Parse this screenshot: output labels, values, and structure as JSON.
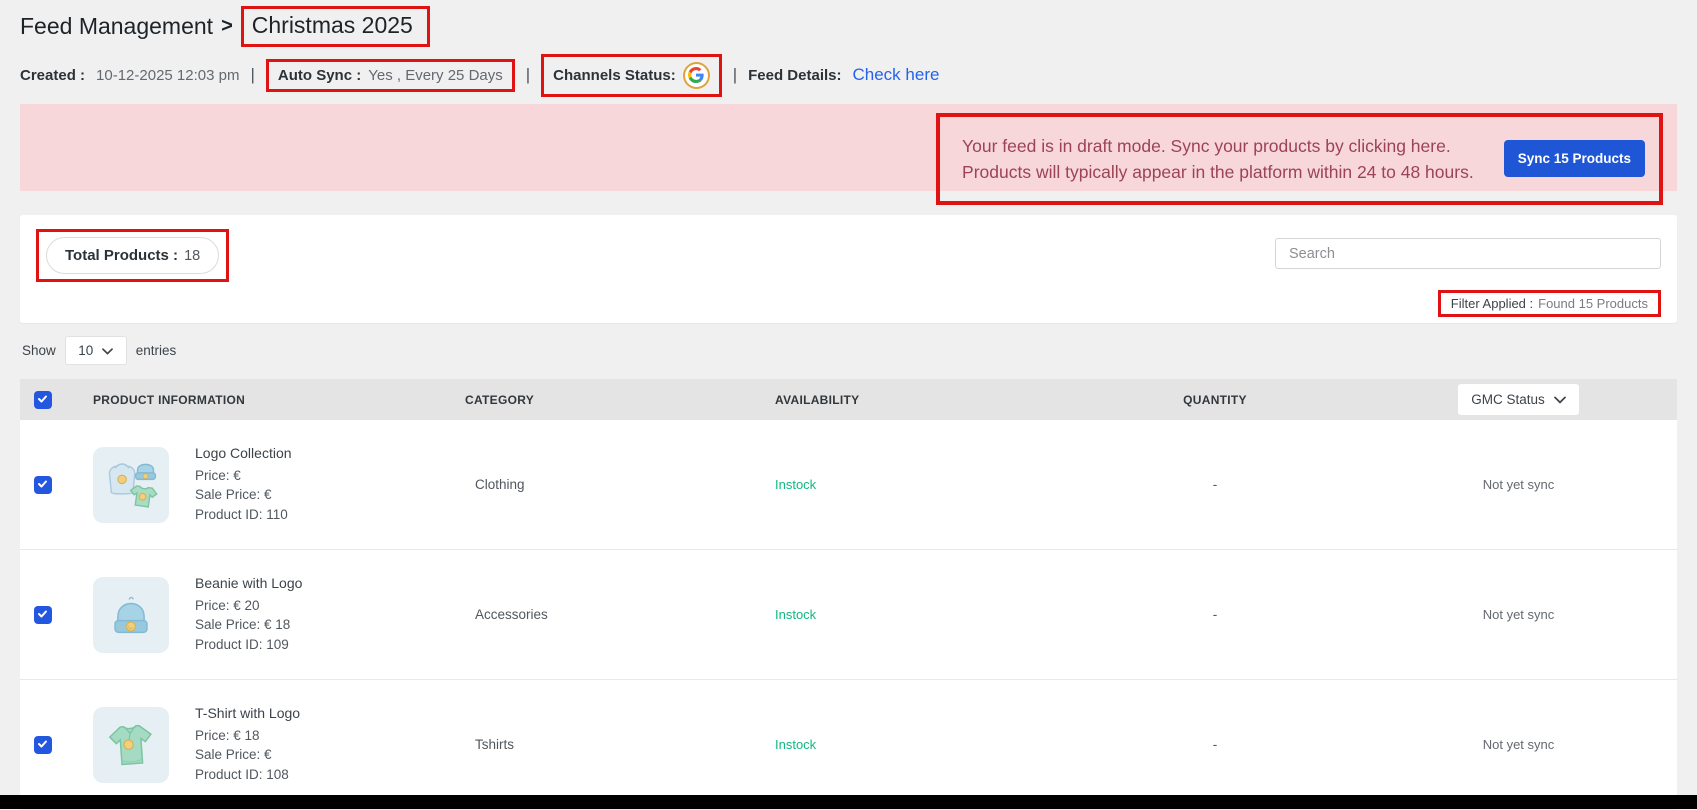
{
  "breadcrumb": {
    "root": "Feed Management",
    "separator": ">",
    "current": "Christmas 2025"
  },
  "meta": {
    "created_label": "Created :",
    "created_value": "10-12-2025 12:03 pm",
    "separator": "|",
    "auto_sync_label": "Auto Sync :",
    "auto_sync_value": "Yes , Every 25 Days",
    "channels_status_label": "Channels Status:",
    "channel_icon": "google-g-icon",
    "feed_details_label": "Feed Details:",
    "feed_details_link": "Check here"
  },
  "alert": {
    "line1": "Your feed is in draft mode. Sync your products by clicking here.",
    "line2": "Products will typically appear in the platform within 24 to 48 hours.",
    "button_label": "Sync 15 Products"
  },
  "toolbar": {
    "total_products_label": "Total Products :",
    "total_products_value": "18",
    "search_placeholder": "Search",
    "filter_applied_label": "Filter Applied :",
    "filter_applied_value": "Found 15 Products"
  },
  "pagination": {
    "show_label": "Show",
    "page_size": "10",
    "entries_label": "entries"
  },
  "table": {
    "columns": [
      "PRODUCT INFORMATION",
      "CATEGORY",
      "AVAILABILITY",
      "QUANTITY"
    ],
    "gmc_status_label": "GMC Status",
    "rows": [
      {
        "name": "Logo Collection",
        "price": "Price: €",
        "sale_price": "Sale Price: €",
        "product_id": "Product ID: 110",
        "category": "Clothing",
        "availability": "Instock",
        "quantity": "-",
        "gmc_status": "Not yet sync",
        "image_icon": "hoodie-beanie-tshirt-collection-illustration"
      },
      {
        "name": "Beanie with Logo",
        "price": "Price: € 20",
        "sale_price": "Sale Price: € 18",
        "product_id": "Product ID: 109",
        "category": "Accessories",
        "availability": "Instock",
        "quantity": "-",
        "gmc_status": "Not yet sync",
        "image_icon": "beanie-illustration"
      },
      {
        "name": "T-Shirt with Logo",
        "price": "Price: € 18",
        "sale_price": "Sale Price: €",
        "product_id": "Product ID: 108",
        "category": "Tshirts",
        "availability": "Instock",
        "quantity": "-",
        "gmc_status": "Not yet sync",
        "image_icon": "tshirt-illustration"
      }
    ]
  },
  "icons": {
    "channel": "google-g-icon",
    "select_chevron": "chevron-down-icon",
    "gmc_chevron": "chevron-down-icon",
    "checkbox": "check-icon"
  },
  "colors": {
    "annotation_red": "#e01313",
    "accent_blue": "#1e56d6",
    "link_blue": "#2563eb",
    "alert_bg": "#f8d7da",
    "alert_text": "#9c4356",
    "instock_green": "#10b981",
    "header_bg": "#e4e4e4",
    "page_bg": "#f0f0f1",
    "checkbox_blue": "#2457e0",
    "bottom_bar": "#000000"
  }
}
